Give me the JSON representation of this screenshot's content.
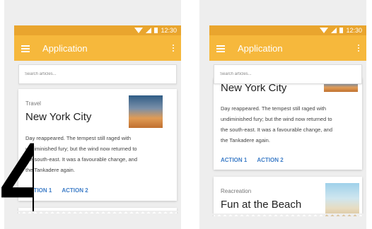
{
  "status_bar": {
    "time": "12:30"
  },
  "app_bar": {
    "title": "Application"
  },
  "search": {
    "placeholder": "Search articles..."
  },
  "cards": [
    {
      "category": "Travel",
      "title": "New York City",
      "body_lines": [
        "Day reappeared. The tempest still raged with",
        "undiminished fury; but the wind now returned to",
        "the south-east. It was a favourable change, and",
        "the Tankadere again."
      ],
      "actions": [
        "ACTION 1",
        "ACTION 2"
      ]
    },
    {
      "category": "Reacreation",
      "title": "Fun at the Beach"
    }
  ],
  "right_scrolled_title": "New York City",
  "overlay_number": "4",
  "colors": {
    "status_bar": "#e9a52e",
    "app_bar": "#f6b83c",
    "action": "#3f7ec8"
  }
}
